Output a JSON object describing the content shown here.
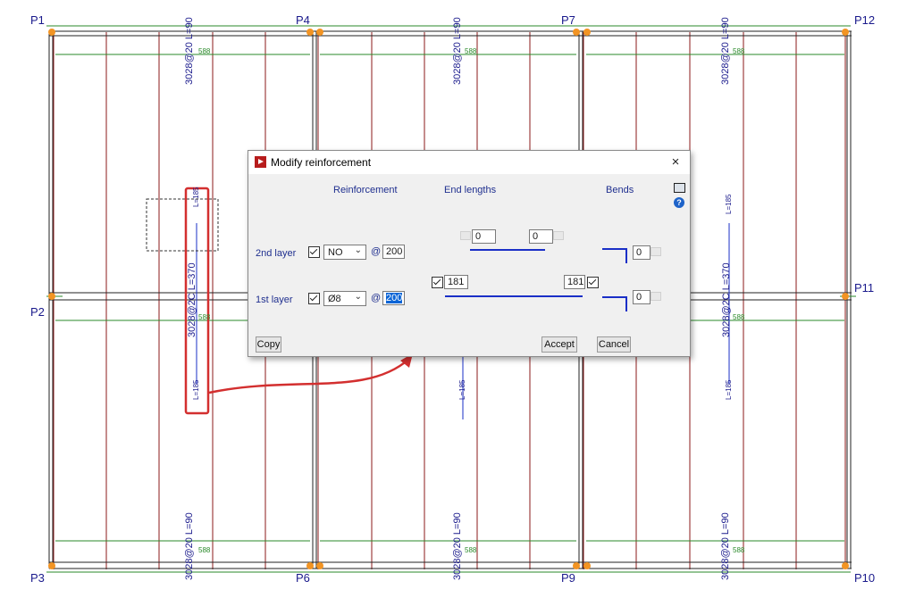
{
  "drawing": {
    "pillars": [
      "P1",
      "P4",
      "P7",
      "P12",
      "P2",
      "P11",
      "P3",
      "P6",
      "P9",
      "P10"
    ],
    "top_labels": [
      "3028@20 L=90",
      "3028@20 L=90",
      "3028@20 L=90"
    ],
    "bottom_labels": [
      "3028@20 L=90",
      "3028@20 L=90",
      "3028@20 L=90"
    ],
    "side_label": "3028@2C L=370",
    "end_label": "L=185",
    "dimension": "588",
    "small_nums": [
      "13",
      "L=7"
    ]
  },
  "dialog": {
    "title": "Modify reinforcement",
    "close": "×",
    "headers": {
      "reinforcement": "Reinforcement",
      "end_lengths": "End lengths",
      "bends": "Bends"
    },
    "layer2": {
      "label": "2nd layer",
      "type": "NO",
      "at": "@",
      "spacing": "200",
      "left_len": "0",
      "right_len": "0",
      "bend": "0"
    },
    "layer1": {
      "label": "1st layer",
      "type": "Ø8",
      "at": "@",
      "spacing": "200",
      "left_len": "181",
      "right_len": "181",
      "bend": "0"
    },
    "buttons": {
      "copy": "Copy",
      "accept": "Accept",
      "cancel": "Cancel"
    },
    "icons": [
      "book-icon",
      "help-icon",
      "checkbox-icon",
      "dropdown-arrow-icon"
    ]
  },
  "colors": {
    "rebar": "#8b1a1a",
    "dimension": "#2a8a2a",
    "text": "#1a1a8c",
    "highlight": "#d32f2f"
  }
}
